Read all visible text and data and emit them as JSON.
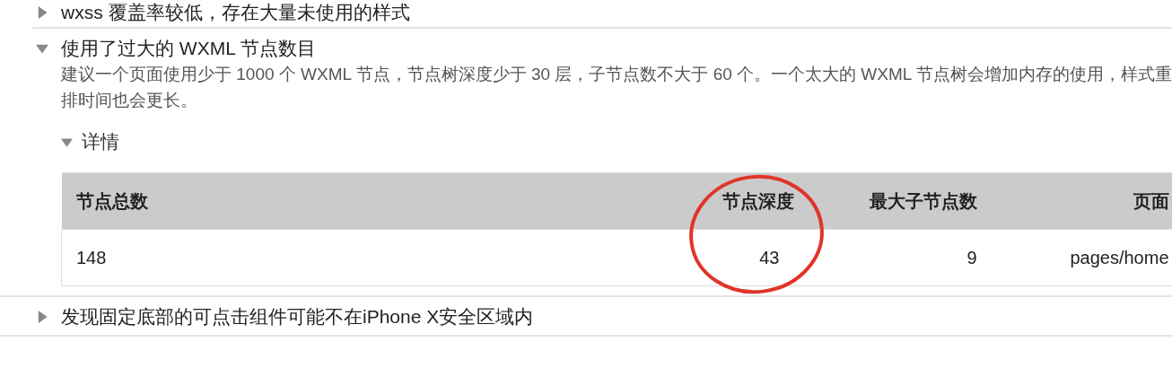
{
  "audits": [
    {
      "title": "wxss 覆盖率较低，存在大量未使用的样式",
      "expanded": false
    },
    {
      "title": "使用了过大的 WXML 节点数目",
      "expanded": true,
      "description": "建议一个页面使用少于 1000 个 WXML 节点，节点树深度少于 30 层，子节点数不大于 60 个。一个太大的 WXML 节点树会增加内存的使用，样式重排时间也会更长。",
      "details": {
        "label": "详情",
        "expanded": true,
        "table": {
          "columns": [
            "节点总数",
            "节点深度",
            "最大子节点数",
            "页面"
          ],
          "rows": [
            [
              "148",
              "43",
              "9",
              "pages/home"
            ]
          ]
        }
      }
    },
    {
      "title": "发现固定底部的可点击组件可能不在iPhone X安全区域内",
      "expanded": false
    }
  ]
}
